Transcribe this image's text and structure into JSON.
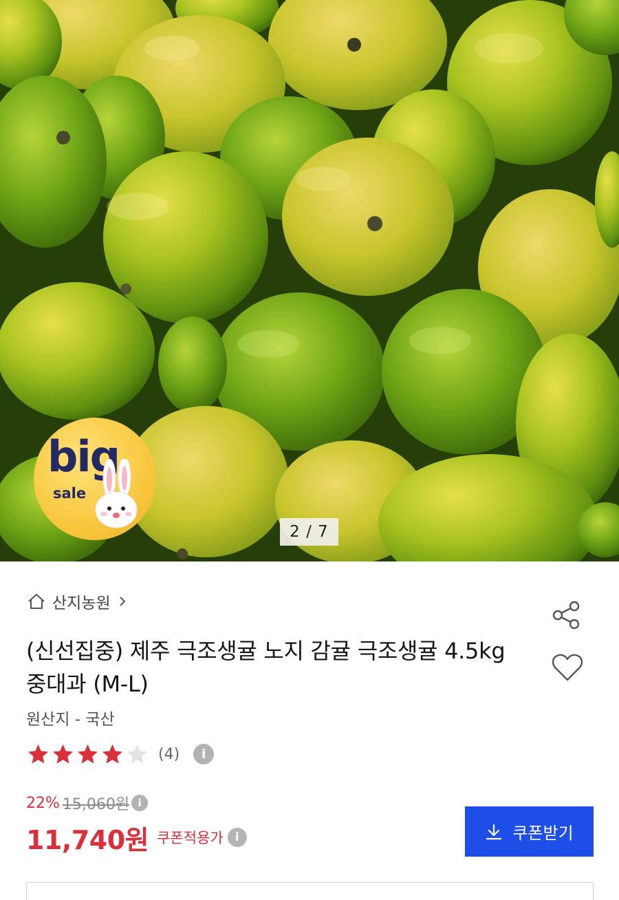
{
  "gallery": {
    "current": 2,
    "total": 7,
    "indicator": "2 / 7",
    "badge": {
      "big": "big",
      "sale": "sale"
    }
  },
  "store": {
    "name": "산지농원"
  },
  "product": {
    "title": "(신선집중) 제주 극조생귤 노지 감귤 극조생귤 4.5kg 중대과 (M-L)",
    "origin": "원산지 - 국산"
  },
  "rating": {
    "stars": 4,
    "max_stars": 5,
    "review_count": "(4)"
  },
  "pricing": {
    "discount_rate": "22%",
    "original_price": "15,060원",
    "price": "11,740원",
    "coupon_note": "쿠폰적용가"
  },
  "buttons": {
    "coupon": "쿠폰받기"
  },
  "icons": {
    "info": "i",
    "home": "home-icon",
    "share": "share-icon",
    "wishlist": "heart-icon",
    "download": "download-icon"
  },
  "colors": {
    "accent_red": "#d9303a",
    "coupon_blue": "#1d4ee7",
    "star_filled": "#d9303a",
    "star_empty": "#e3e3e3"
  }
}
